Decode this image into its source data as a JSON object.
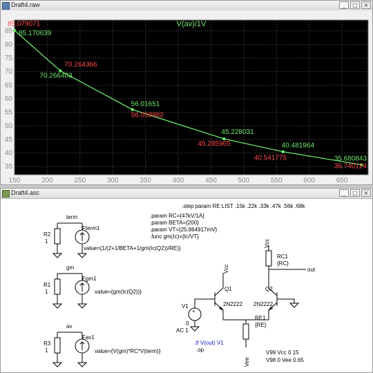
{
  "waveform_window": {
    "title": "Draft4.raw",
    "buttons": [
      "_",
      "□",
      "×"
    ]
  },
  "schematic_window": {
    "title": "Draft4.asc",
    "buttons": [
      "_",
      "□",
      "×"
    ]
  },
  "chart_data": {
    "type": "line",
    "title": "V(av)/1V",
    "xlabel": "",
    "ylabel": "",
    "xlim": [
      150,
      690
    ],
    "ylim": [
      32,
      89
    ],
    "x_ticks": [
      150,
      200,
      250,
      300,
      350,
      400,
      450,
      500,
      550,
      600,
      650
    ],
    "y_ticks": [
      35,
      40,
      45,
      50,
      55,
      60,
      65,
      70,
      75,
      80,
      85
    ],
    "grid": true,
    "background": "#000000",
    "series": [
      {
        "name": "V(av)/1V",
        "color": "#6ee86e",
        "x": [
          150,
          220,
          330,
          470,
          560,
          680
        ],
        "y": [
          85.170639,
          70.266403,
          56.01651,
          45.228031,
          40.481964,
          35.680843
        ]
      }
    ],
    "annotations": [
      {
        "text": "85.079071",
        "x": 150,
        "y": 85.079071,
        "color": "#ff4a4a"
      },
      {
        "text": "85.170639",
        "x": 150,
        "y": 85.170639,
        "color": "#6ee86e"
      },
      {
        "text": "70.264366",
        "x": 220,
        "y": 70.264366,
        "color": "#ff4a4a"
      },
      {
        "text": "70.266403",
        "x": 220,
        "y": 70.266403,
        "color": "#6ee86e"
      },
      {
        "text": "56.01651",
        "x": 330,
        "y": 56.01651,
        "color": "#6ee86e"
      },
      {
        "text": "56.059982",
        "x": 330,
        "y": 56.059982,
        "color": "#ff4a4a"
      },
      {
        "text": "45.228031",
        "x": 470,
        "y": 45.228031,
        "color": "#6ee86e"
      },
      {
        "text": "45.285965",
        "x": 470,
        "y": 45.285965,
        "color": "#ff4a4a"
      },
      {
        "text": "40.481964",
        "x": 560,
        "y": 40.481964,
        "color": "#6ee86e"
      },
      {
        "text": "40.541775",
        "x": 560,
        "y": 40.541775,
        "color": "#ff4a4a"
      },
      {
        "text": "35.680843",
        "x": 680,
        "y": 35.680843,
        "color": "#6ee86e"
      },
      {
        "text": "35.740124",
        "x": 680,
        "y": 35.740124,
        "color": "#ff4a4a"
      }
    ]
  },
  "schematic": {
    "directives": {
      "step": ".step param RE LIST .15k .22k .33k .47k .56k .68k",
      "p1": ".param RC={47kV/1A}",
      "p2": ".param BETA={200}",
      "p3": ".param VT={25.864917mV}",
      "p4": ".func gm(Ic)={Ic/VT}",
      "tf": ".tf V(out) V1",
      "op": ".op",
      "v99": "V99 Vcc 0 15",
      "v98": "V98 0 Vee 0.65"
    },
    "labels": {
      "term": "term",
      "fterm1": "Fterm1",
      "r2": "R2",
      "r2v": "1",
      "fterm1_value": "value={1/(2+1/BETA+1/gm(Ic(Q2))/RE)}",
      "gm": "gm",
      "fgm1": "Fgm1",
      "r1": "R1",
      "r1v": "1",
      "fgm1_value": "value={gm(Ic(Q2))}",
      "av": "av",
      "fav1": "Fav1",
      "r3": "R3",
      "r3v": "1",
      "fav1_value": "value={V(gm)*RC*V(term)}",
      "v1": "V1",
      "v1_0": "0",
      "v1_ac": "AC 1",
      "vcc1": "Vcc",
      "vcc2": "Vcc",
      "vee": "Vee",
      "q1": "Q1",
      "q1m": "2N2222",
      "q2": "Q2",
      "q2m": "2N2222",
      "rc1": "RC1",
      "rc1v": "{RC}",
      "out": "out",
      "re1": "RE1",
      "re1v": "{RE}"
    }
  }
}
